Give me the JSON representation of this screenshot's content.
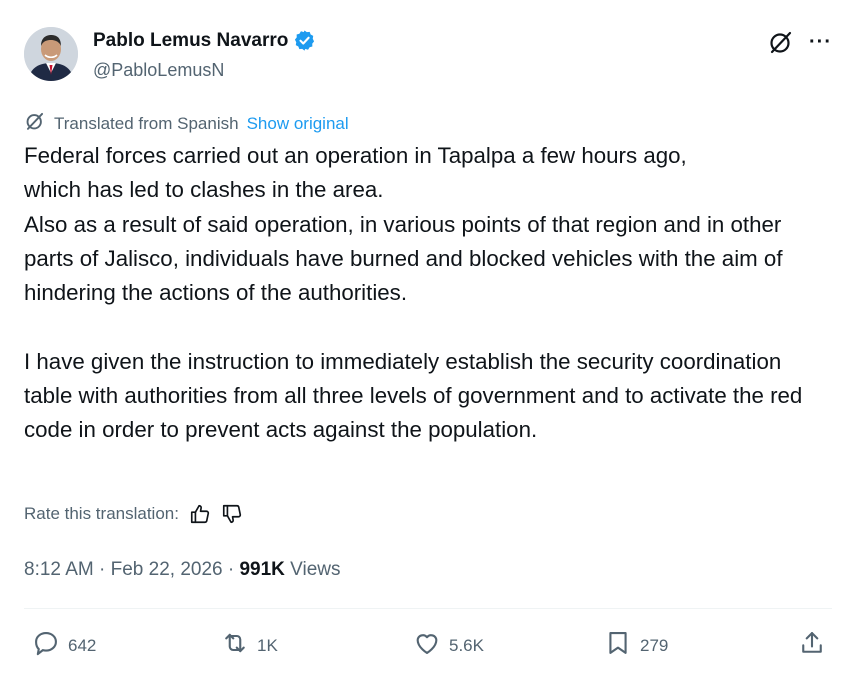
{
  "author": {
    "name": "Pablo Lemus Navarro",
    "handle": "@PabloLemusN",
    "verified": true
  },
  "translation": {
    "label": "Translated from Spanish",
    "show_original": "Show original",
    "rate_label": "Rate this translation:"
  },
  "tweet": {
    "text": "Federal forces carried out an operation in Tapalpa a few hours ago,\nwhich has led to clashes in the area.\nAlso as a result of said operation, in various points of that region and in other parts of Jalisco, individuals have burned and blocked vehicles with the aim of hindering the actions of the authorities.\n\nI have given the instruction to immediately establish the security coordination table with authorities from all three levels of government and to activate the red code in order to prevent acts against the population."
  },
  "meta": {
    "time": "8:12 AM",
    "sep1": " · ",
    "date": "Feb 22, 2026",
    "sep2": " · ",
    "views_count": "991K",
    "views_label": " Views"
  },
  "actions": {
    "replies": "642",
    "reposts": "1K",
    "likes": "5.6K",
    "bookmarks": "279"
  },
  "colors": {
    "accent": "#1d9bf0",
    "text": "#0f1419",
    "muted": "#536471"
  },
  "icons": [
    "verified-badge-icon",
    "grok-icon",
    "more-icon",
    "thumbs-up-icon",
    "thumbs-down-icon",
    "reply-icon",
    "repost-icon",
    "like-icon",
    "bookmark-icon",
    "share-icon"
  ]
}
